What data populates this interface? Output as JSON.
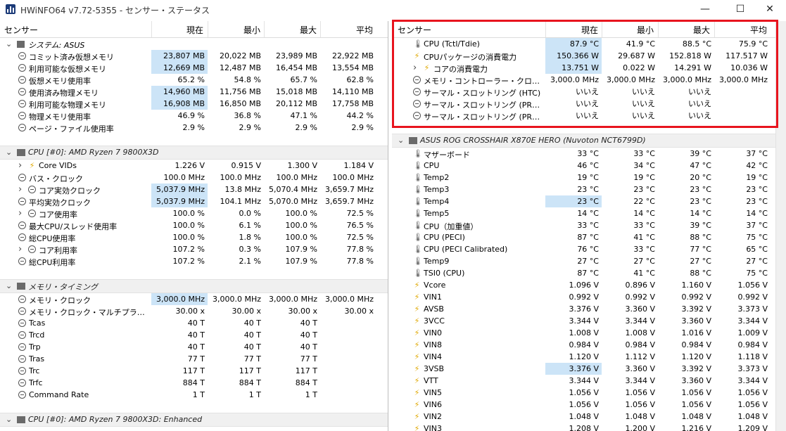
{
  "window": {
    "title": "HWiNFO64 v7.72-5355 - センサー・ステータス",
    "min": "—",
    "max": "☐",
    "close": "✕"
  },
  "columns": {
    "sensor": "センサー",
    "current": "現在",
    "min": "最小",
    "max": "最大",
    "avg": "平均"
  },
  "left": {
    "groups": [
      {
        "title": "システム: ASUS",
        "rows": [
          {
            "name": "コミット済み仮想メモリ",
            "icon": "clock",
            "cur": "23,807 MB",
            "min": "20,022 MB",
            "max": "23,989 MB",
            "avg": "22,922 MB",
            "hl": true
          },
          {
            "name": "利用可能な仮想メモリ",
            "icon": "clock",
            "cur": "12,669 MB",
            "min": "12,487 MB",
            "max": "16,454 MB",
            "avg": "13,554 MB",
            "hl": true
          },
          {
            "name": "仮想メモリ使用率",
            "icon": "clock",
            "cur": "65.2 %",
            "min": "54.8 %",
            "max": "65.7 %",
            "avg": "62.8 %"
          },
          {
            "name": "使用済み物理メモリ",
            "icon": "clock",
            "cur": "14,960 MB",
            "min": "11,756 MB",
            "max": "15,018 MB",
            "avg": "14,110 MB",
            "hl": true
          },
          {
            "name": "利用可能な物理メモリ",
            "icon": "clock",
            "cur": "16,908 MB",
            "min": "16,850 MB",
            "max": "20,112 MB",
            "avg": "17,758 MB",
            "hl": true
          },
          {
            "name": "物理メモリ使用率",
            "icon": "clock",
            "cur": "46.9 %",
            "min": "36.8 %",
            "max": "47.1 %",
            "avg": "44.2 %"
          },
          {
            "name": "ページ・ファイル使用率",
            "icon": "clock",
            "cur": "2.9 %",
            "min": "2.9 %",
            "max": "2.9 %",
            "avg": "2.9 %"
          }
        ]
      },
      {
        "title": "CPU [#0]: AMD Ryzen 7 9800X3D",
        "rows": [
          {
            "name": "Core VIDs",
            "icon": "bolt",
            "expand": true,
            "cur": "1.226 V",
            "min": "0.915 V",
            "max": "1.300 V",
            "avg": "1.184 V"
          },
          {
            "name": "バス・クロック",
            "icon": "clock",
            "cur": "100.0 MHz",
            "min": "100.0 MHz",
            "max": "100.0 MHz",
            "avg": "100.0 MHz"
          },
          {
            "name": "コア実効クロック",
            "icon": "clock",
            "expand": true,
            "cur": "5,037.9 MHz",
            "min": "13.8 MHz",
            "max": "5,070.4 MHz",
            "avg": "3,659.7 MHz",
            "hl": true
          },
          {
            "name": "平均実効クロック",
            "icon": "clock",
            "cur": "5,037.9 MHz",
            "min": "104.1 MHz",
            "max": "5,070.0 MHz",
            "avg": "3,659.7 MHz",
            "hl": true
          },
          {
            "name": "コア使用率",
            "icon": "clock",
            "expand": true,
            "cur": "100.0 %",
            "min": "0.0 %",
            "max": "100.0 %",
            "avg": "72.5 %"
          },
          {
            "name": "最大CPU/スレッド使用率",
            "icon": "clock",
            "cur": "100.0 %",
            "min": "6.1 %",
            "max": "100.0 %",
            "avg": "76.5 %"
          },
          {
            "name": "総CPU使用率",
            "icon": "clock",
            "cur": "100.0 %",
            "min": "1.8 %",
            "max": "100.0 %",
            "avg": "72.5 %"
          },
          {
            "name": "コア利用率",
            "icon": "clock",
            "expand": true,
            "cur": "107.2 %",
            "min": "0.3 %",
            "max": "107.9 %",
            "avg": "77.8 %"
          },
          {
            "name": "総CPU利用率",
            "icon": "clock",
            "cur": "107.2 %",
            "min": "2.1 %",
            "max": "107.9 %",
            "avg": "77.8 %"
          }
        ]
      },
      {
        "title": "メモリ・タイミング",
        "rows": [
          {
            "name": "メモリ・クロック",
            "icon": "clock",
            "cur": "3,000.0 MHz",
            "min": "3,000.0 MHz",
            "max": "3,000.0 MHz",
            "avg": "3,000.0 MHz",
            "hl": true
          },
          {
            "name": "メモリ・クロック・マルチプライヤー",
            "icon": "clock",
            "cur": "30.00 x",
            "min": "30.00 x",
            "max": "30.00 x",
            "avg": "30.00 x"
          },
          {
            "name": "Tcas",
            "icon": "clock",
            "cur": "40 T",
            "min": "40 T",
            "max": "40 T",
            "avg": ""
          },
          {
            "name": "Trcd",
            "icon": "clock",
            "cur": "40 T",
            "min": "40 T",
            "max": "40 T",
            "avg": ""
          },
          {
            "name": "Trp",
            "icon": "clock",
            "cur": "40 T",
            "min": "40 T",
            "max": "40 T",
            "avg": ""
          },
          {
            "name": "Tras",
            "icon": "clock",
            "cur": "77 T",
            "min": "77 T",
            "max": "77 T",
            "avg": ""
          },
          {
            "name": "Trc",
            "icon": "clock",
            "cur": "117 T",
            "min": "117 T",
            "max": "117 T",
            "avg": ""
          },
          {
            "name": "Trfc",
            "icon": "clock",
            "cur": "884 T",
            "min": "884 T",
            "max": "884 T",
            "avg": ""
          },
          {
            "name": "Command Rate",
            "icon": "clock",
            "cur": "1 T",
            "min": "1 T",
            "max": "1 T",
            "avg": ""
          }
        ]
      },
      {
        "title": "CPU [#0]: AMD Ryzen 7 9800X3D: Enhanced",
        "rows": []
      }
    ]
  },
  "right": {
    "top_rows": [
      {
        "name": "CPU (Tctl/Tdie)",
        "icon": "therm",
        "cur": "87.9 °C",
        "min": "41.9 °C",
        "max": "88.5 °C",
        "avg": "75.9 °C",
        "hl": true
      },
      {
        "name": "CPUパッケージの消費電力",
        "icon": "bolt",
        "cur": "150.366 W",
        "min": "29.687 W",
        "max": "152.818 W",
        "avg": "117.517 W",
        "hl": true
      },
      {
        "name": "コアの消費電力",
        "icon": "bolt",
        "expand": true,
        "cur": "13.751 W",
        "min": "0.022 W",
        "max": "14.291 W",
        "avg": "10.036 W",
        "hl": true
      },
      {
        "name": "メモリ・コントローラー・クロック（UCL...",
        "icon": "clock",
        "cur": "3,000.0 MHz",
        "min": "3,000.0 MHz",
        "max": "3,000.0 MHz",
        "avg": "3,000.0 MHz"
      },
      {
        "name": "サーマル・スロットリング (HTC)",
        "icon": "clock",
        "cur": "いいえ",
        "min": "いいえ",
        "max": "いいえ",
        "avg": ""
      },
      {
        "name": "サーマル・スロットリング (PROCHOT ...",
        "icon": "clock",
        "cur": "いいえ",
        "min": "いいえ",
        "max": "いいえ",
        "avg": ""
      },
      {
        "name": "サーマル・スロットリング (PROCHOT ...",
        "icon": "clock",
        "cur": "いいえ",
        "min": "いいえ",
        "max": "いいえ",
        "avg": ""
      }
    ],
    "group_title": "ASUS ROG CROSSHAIR X870E HERO (Nuvoton NCT6799D)",
    "rows": [
      {
        "name": "マザーボード",
        "icon": "therm",
        "cur": "33 °C",
        "min": "33 °C",
        "max": "39 °C",
        "avg": "37 °C"
      },
      {
        "name": "CPU",
        "icon": "therm",
        "cur": "46 °C",
        "min": "34 °C",
        "max": "47 °C",
        "avg": "42 °C"
      },
      {
        "name": "Temp2",
        "icon": "therm",
        "cur": "19 °C",
        "min": "19 °C",
        "max": "20 °C",
        "avg": "19 °C"
      },
      {
        "name": "Temp3",
        "icon": "therm",
        "cur": "23 °C",
        "min": "23 °C",
        "max": "23 °C",
        "avg": "23 °C"
      },
      {
        "name": "Temp4",
        "icon": "therm",
        "cur": "23 °C",
        "min": "22 °C",
        "max": "23 °C",
        "avg": "23 °C",
        "hl": true
      },
      {
        "name": "Temp5",
        "icon": "therm",
        "cur": "14 °C",
        "min": "14 °C",
        "max": "14 °C",
        "avg": "14 °C"
      },
      {
        "name": "CPU（加重値）",
        "icon": "therm",
        "cur": "33 °C",
        "min": "33 °C",
        "max": "39 °C",
        "avg": "37 °C"
      },
      {
        "name": "CPU (PECI)",
        "icon": "therm",
        "cur": "87 °C",
        "min": "41 °C",
        "max": "88 °C",
        "avg": "75 °C"
      },
      {
        "name": "CPU (PECI Calibrated)",
        "icon": "therm",
        "cur": "76 °C",
        "min": "33 °C",
        "max": "77 °C",
        "avg": "65 °C"
      },
      {
        "name": "Temp9",
        "icon": "therm",
        "cur": "27 °C",
        "min": "27 °C",
        "max": "27 °C",
        "avg": "27 °C"
      },
      {
        "name": "TSI0 (CPU)",
        "icon": "therm",
        "cur": "87 °C",
        "min": "41 °C",
        "max": "88 °C",
        "avg": "75 °C"
      },
      {
        "name": "Vcore",
        "icon": "bolt",
        "cur": "1.096 V",
        "min": "0.896 V",
        "max": "1.160 V",
        "avg": "1.056 V"
      },
      {
        "name": "VIN1",
        "icon": "bolt",
        "cur": "0.992 V",
        "min": "0.992 V",
        "max": "0.992 V",
        "avg": "0.992 V"
      },
      {
        "name": "AVSB",
        "icon": "bolt",
        "cur": "3.376 V",
        "min": "3.360 V",
        "max": "3.392 V",
        "avg": "3.373 V"
      },
      {
        "name": "3VCC",
        "icon": "bolt",
        "cur": "3.344 V",
        "min": "3.344 V",
        "max": "3.360 V",
        "avg": "3.344 V"
      },
      {
        "name": "VIN0",
        "icon": "bolt",
        "cur": "1.008 V",
        "min": "1.008 V",
        "max": "1.016 V",
        "avg": "1.009 V"
      },
      {
        "name": "VIN8",
        "icon": "bolt",
        "cur": "0.984 V",
        "min": "0.984 V",
        "max": "0.984 V",
        "avg": "0.984 V"
      },
      {
        "name": "VIN4",
        "icon": "bolt",
        "cur": "1.120 V",
        "min": "1.112 V",
        "max": "1.120 V",
        "avg": "1.118 V"
      },
      {
        "name": "3VSB",
        "icon": "bolt",
        "cur": "3.376 V",
        "min": "3.360 V",
        "max": "3.392 V",
        "avg": "3.373 V",
        "hl": true
      },
      {
        "name": "VTT",
        "icon": "bolt",
        "cur": "3.344 V",
        "min": "3.344 V",
        "max": "3.360 V",
        "avg": "3.344 V"
      },
      {
        "name": "VIN5",
        "icon": "bolt",
        "cur": "1.056 V",
        "min": "1.056 V",
        "max": "1.056 V",
        "avg": "1.056 V"
      },
      {
        "name": "VIN6",
        "icon": "bolt",
        "cur": "1.056 V",
        "min": "1.056 V",
        "max": "1.056 V",
        "avg": "1.056 V"
      },
      {
        "name": "VIN2",
        "icon": "bolt",
        "cur": "1.048 V",
        "min": "1.048 V",
        "max": "1.048 V",
        "avg": "1.048 V"
      },
      {
        "name": "VIN3",
        "icon": "bolt",
        "cur": "1.208 V",
        "min": "1.200 V",
        "max": "1.216 V",
        "avg": "1.209 V"
      }
    ]
  },
  "colors": {
    "highlight": "#cce4f7",
    "annotation_box": "#e8141e",
    "group_bg": "#f0f0f0"
  }
}
